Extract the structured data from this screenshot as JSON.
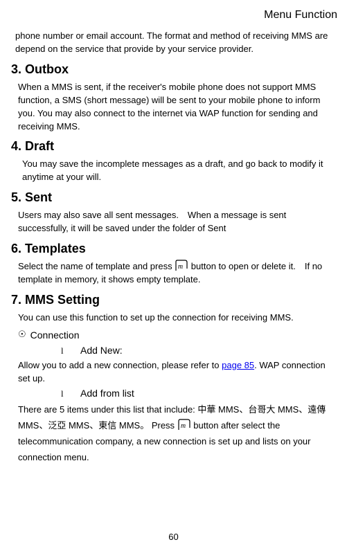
{
  "header": "Menu Function",
  "intro": "phone number or email account. The format and method of receiving MMS are depend on the service that provide by your service provider.",
  "sections": {
    "outbox": {
      "heading": "3. Outbox",
      "body": "When a MMS is sent, if the receiver's mobile phone does not support MMS function, a SMS (short message) will be sent to your mobile phone to inform you. You may also connect to the internet via WAP function for sending and receiving MMS."
    },
    "draft": {
      "heading": "4. Draft",
      "body": "You may save the incomplete messages as a draft, and go back to modify it anytime at your will."
    },
    "sent": {
      "heading": "5. Sent",
      "body": "Users may also save all sent messages. When a message is sent successfully, it will be saved under the folder of Sent"
    },
    "templates": {
      "heading": "6. Templates",
      "body_before": "Select the name of template and press ",
      "body_after": " button to open or delete it. If no template in memory, it shows empty template."
    },
    "mms": {
      "heading": "7. MMS Setting",
      "intro": "You can use this function to set up the connection for receiving MMS.",
      "connection_label": "Connection",
      "add_new": {
        "label": "Add New:",
        "body_before": "Allow you to add a new connection, please refer to ",
        "link": "page 85",
        "body_after": ". WAP connection set up."
      },
      "add_list": {
        "label": "Add from list",
        "body_before": "There are 5 items under this list that include: 中華 MMS、台哥大 MMS、遠傳 MMS、泛亞 MMS、東信 MMS。 Press ",
        "body_after": " button after select the telecommunication company, a new connection is set up and lists on your connection menu."
      }
    }
  },
  "page_number": "60"
}
